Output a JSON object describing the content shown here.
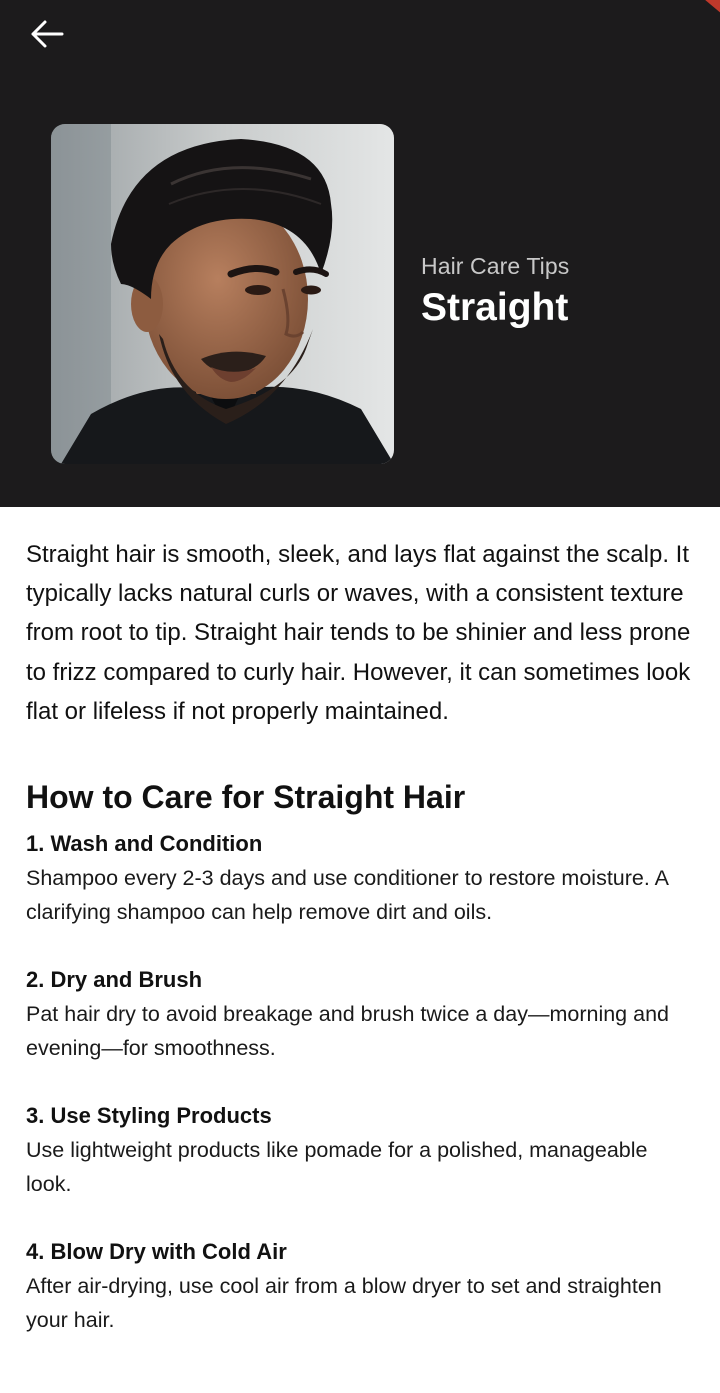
{
  "header": {
    "back_icon": "arrow-left-icon",
    "eyebrow": "Hair Care Tips",
    "title": "Straight",
    "hero_image_icon": "man-portrait-photo",
    "accent_color": "#c0392b",
    "background_color": "#1c1b1c"
  },
  "intro": "Straight hair is smooth, sleek, and lays flat against the scalp. It typically lacks natural curls or waves, with a consistent texture from root to tip. Straight hair tends to be shinier and less prone to frizz compared to curly hair. However, it can sometimes look flat or lifeless if not properly maintained.",
  "care_section": {
    "heading": "How to Care for Straight Hair",
    "tips": [
      {
        "title": "1. Wash and Condition",
        "body": "Shampoo every 2-3 days and use conditioner to restore moisture. A clarifying shampoo can help remove dirt and oils."
      },
      {
        "title": "2. Dry and Brush",
        "body": "Pat hair dry to avoid breakage and brush twice a day—morning and evening—for smoothness."
      },
      {
        "title": "3. Use Styling Products",
        "body": "Use lightweight products like pomade for a polished, manageable look."
      },
      {
        "title": "4. Blow Dry with Cold Air",
        "body": "After air-drying, use cool air from a blow dryer to set and straighten your hair."
      }
    ]
  }
}
